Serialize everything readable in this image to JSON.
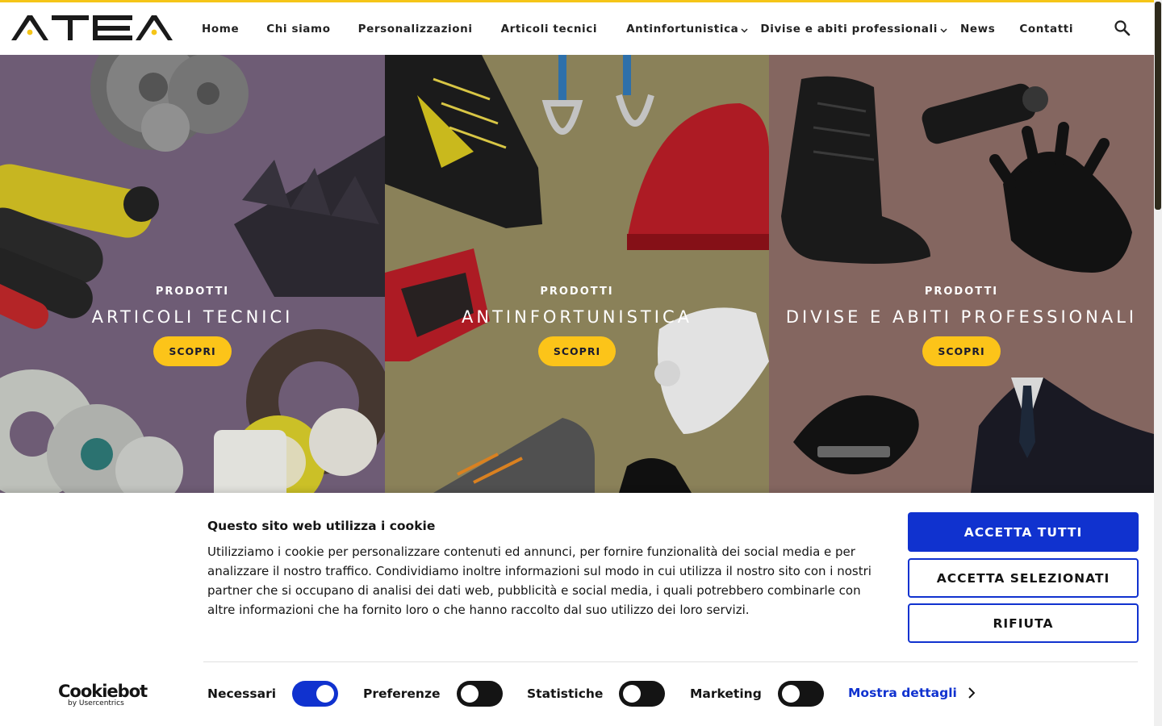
{
  "brand": {
    "logo_text": "ATEA",
    "accent": "#f5c518"
  },
  "nav": {
    "items": [
      {
        "label": "Home",
        "dropdown": false
      },
      {
        "label": "Chi siamo",
        "dropdown": false
      },
      {
        "label": "Personalizzazioni",
        "dropdown": false
      },
      {
        "label": "Articoli tecnici",
        "dropdown": false
      },
      {
        "label": "Antinfortunistica",
        "dropdown": true
      },
      {
        "label": "Divise e abiti professionali",
        "dropdown": true
      },
      {
        "label": "News",
        "dropdown": false
      },
      {
        "label": "Contatti",
        "dropdown": false
      }
    ],
    "search_icon": "search-icon"
  },
  "panels": [
    {
      "kicker": "PRODOTTI",
      "title": "ARTICOLI TECNICI",
      "button": "SCOPRI",
      "bg": "#75627d"
    },
    {
      "kicker": "PRODOTTI",
      "title": "ANTINFORTUNISTICA",
      "button": "SCOPRI",
      "bg": "#938a5f"
    },
    {
      "kicker": "PRODOTTI",
      "title": "DIVISE E ABITI PROFESSIONALI",
      "button": "SCOPRI",
      "bg": "#8d6d67"
    }
  ],
  "cookie": {
    "title": "Questo sito web utilizza i cookie",
    "text": "Utilizziamo i cookie per personalizzare contenuti ed annunci, per fornire funzionalità dei social media e per analizzare il nostro traffico. Condividiamo inoltre informazioni sul modo in cui utilizza il nostro sito con i nostri partner che si occupano di analisi dei dati web, pubblicità e social media, i quali potrebbero combinarle con altre informazioni che ha fornito loro o che hanno raccolto dal suo utilizzo dei loro servizi.",
    "accept_all": "ACCETTA TUTTI",
    "accept_selected": "ACCETTA SELEZIONATI",
    "reject": "RIFIUTA",
    "brand": "Cookiebot",
    "brand_sub": "by Usercentrics",
    "toggles": [
      {
        "label": "Necessari",
        "on": true
      },
      {
        "label": "Preferenze",
        "on": false
      },
      {
        "label": "Statistiche",
        "on": false
      },
      {
        "label": "Marketing",
        "on": false
      }
    ],
    "details": "Mostra dettagli",
    "accent": "#1032cf"
  }
}
